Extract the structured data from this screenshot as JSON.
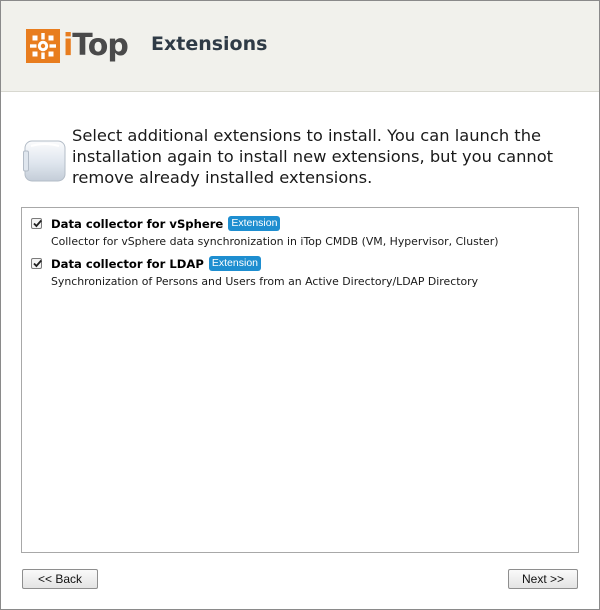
{
  "header": {
    "logo_i": "i",
    "logo_top": "Top",
    "title": "Extensions"
  },
  "intro": {
    "text": "Select additional extensions to install. You can launch the installation again to install new extensions, but you cannot remove already installed extensions."
  },
  "extensions": [
    {
      "name": "Data collector for vSphere",
      "badge": "Extension",
      "description": "Collector for vSphere data synchronization in iTop CMDB (VM, Hypervisor, Cluster)",
      "checked": true
    },
    {
      "name": "Data collector for LDAP",
      "badge": "Extension",
      "description": "Synchronization of Persons and Users from an Active Directory/LDAP Directory",
      "checked": true
    }
  ],
  "buttons": {
    "back_label": "<< Back",
    "next_label": "Next >>"
  },
  "colors": {
    "brand_orange": "#e87d1e",
    "badge_blue": "#1e8ed0",
    "header_bg": "#f1f1ec"
  },
  "icons": {
    "logo": "itop-logo-icon",
    "intro": "extension-box-icon",
    "check": "check-icon"
  }
}
